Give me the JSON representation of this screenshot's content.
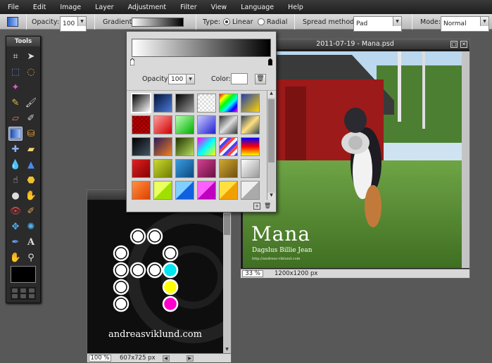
{
  "menu": [
    "File",
    "Edit",
    "Image",
    "Layer",
    "Adjustment",
    "Filter",
    "View",
    "Language",
    "Help"
  ],
  "options": {
    "opacity_label": "Opacity:",
    "opacity_value": "100",
    "gradient_label": "Gradient:",
    "type_label": "Type:",
    "type_linear": "Linear",
    "type_radial": "Radial",
    "spread_label": "Spread method:",
    "spread_value": "Pad",
    "mode_label": "Mode:",
    "mode_value": "Normal"
  },
  "tools": {
    "title": "Tools",
    "letter_tool": "A"
  },
  "gradient_picker": {
    "opacity_label": "Opacity:",
    "opacity_value": "100",
    "color_label": "Color:"
  },
  "doc_mana": {
    "title": "2011-07-19 - Mana.psd",
    "zoom": "33",
    "zoom_unit": "%",
    "size": "1200x1200 px",
    "caption_title": "Mana",
    "caption_sub": "Dagslus Billie Jean",
    "caption_small": "http://andreas-viklund.com"
  },
  "doc_logo": {
    "zoom": "100",
    "zoom_unit": "%",
    "size": "607x725 px",
    "site": "andreasviklund.com"
  },
  "colors": {
    "accent": "#7e93b7",
    "cyan": "#00e6f0",
    "yellow": "#ffff00",
    "magenta": "#ff00cc"
  }
}
